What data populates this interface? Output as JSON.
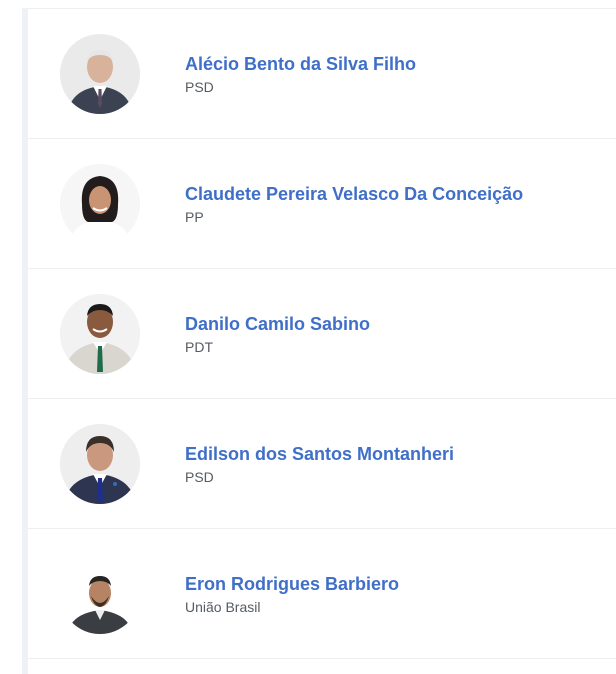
{
  "members": [
    {
      "name": "Alécio Bento da Silva Filho",
      "party": "PSD",
      "photo_icon": "person-photo"
    },
    {
      "name": "Claudete Pereira Velasco Da Conceição",
      "party": "PP",
      "photo_icon": "person-photo"
    },
    {
      "name": "Danilo Camilo Sabino",
      "party": "PDT",
      "photo_icon": "person-photo"
    },
    {
      "name": "Edilson dos Santos Montanheri",
      "party": "PSD",
      "photo_icon": "person-photo"
    },
    {
      "name": "Eron Rodrigues Barbiero",
      "party": "União Brasil",
      "photo_icon": "person-photo"
    }
  ]
}
